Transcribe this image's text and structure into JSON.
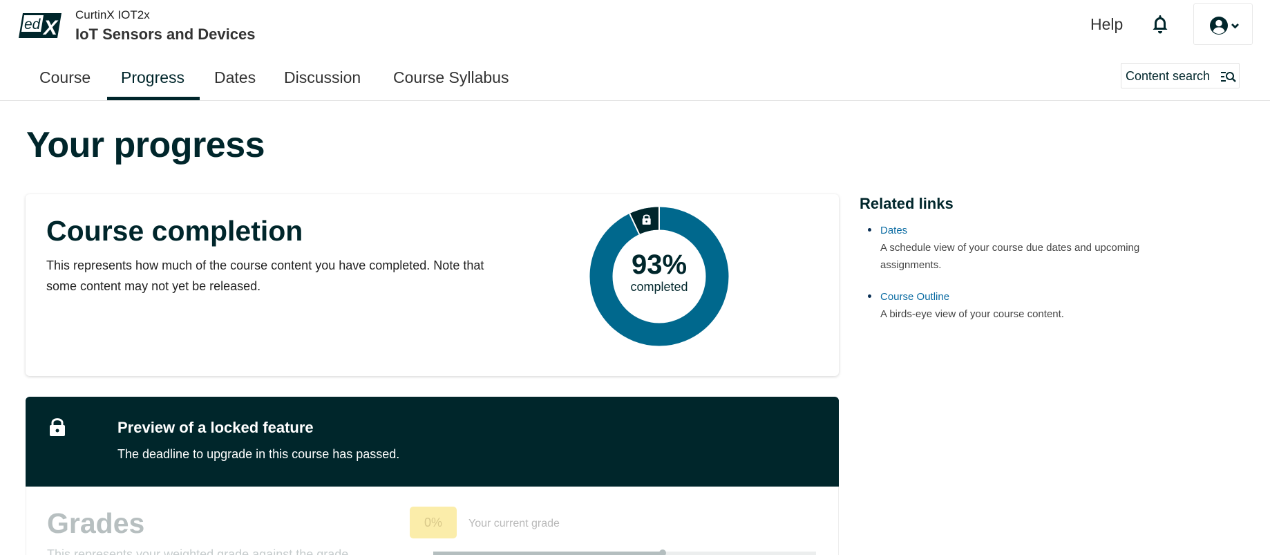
{
  "header": {
    "logo_text": "edX",
    "course_org": "CurtinX IOT2x",
    "course_title": "IoT Sensors and Devices",
    "help_label": "Help"
  },
  "nav": {
    "tabs": [
      {
        "label": "Course"
      },
      {
        "label": "Progress"
      },
      {
        "label": "Dates"
      },
      {
        "label": "Discussion"
      },
      {
        "label": "Course Syllabus"
      }
    ],
    "active_tab": "Progress",
    "search_label": "Content search"
  },
  "page_title": "Your progress",
  "completion": {
    "title": "Course completion",
    "description": "This represents how much of the course content you have completed. Note that some content may not yet be released.",
    "percent_label": "93%",
    "completed_label": "completed",
    "completed_fraction": 0.93,
    "locked_fraction": 0.07,
    "colors": {
      "complete": "#00688d",
      "locked": "#00262b"
    }
  },
  "locked_feature": {
    "title": "Preview of a locked feature",
    "message": "The deadline to upgrade in this course has passed."
  },
  "grades": {
    "title": "Grades",
    "description": "This represents your weighted grade against the grade",
    "current_grade": "0%",
    "current_grade_label": "Your current grade",
    "passing_fraction": 0.6
  },
  "related": {
    "title": "Related links",
    "links": [
      {
        "label": "Dates",
        "description": "A schedule view of your course due dates and upcoming assignments."
      },
      {
        "label": "Course Outline",
        "description": "A birds-eye view of your course content."
      }
    ]
  }
}
